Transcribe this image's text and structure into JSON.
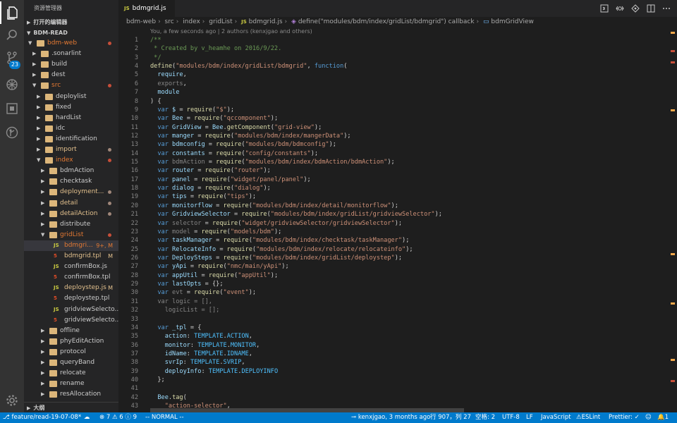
{
  "sidebar": {
    "title": "资源管理器",
    "open_editors": "打开的编辑器",
    "workspace": "BDM-READ",
    "outline": "大纲",
    "tree": [
      {
        "label": "bdm-web",
        "level": 1,
        "kind": "folder-open",
        "color": "#e37933",
        "status": "",
        "dot": "#c74e39"
      },
      {
        "label": ".sonarlint",
        "level": 2,
        "kind": "folder",
        "color": "#cccccc",
        "status": "",
        "dot": ""
      },
      {
        "label": "build",
        "level": 2,
        "kind": "folder",
        "color": "#cccccc",
        "status": "",
        "dot": ""
      },
      {
        "label": "dest",
        "level": 2,
        "kind": "folder",
        "color": "#cccccc",
        "status": "",
        "dot": ""
      },
      {
        "label": "src",
        "level": 2,
        "kind": "folder-open",
        "color": "#e37933",
        "status": "",
        "dot": "#c74e39"
      },
      {
        "label": "deploylist",
        "level": 3,
        "kind": "folder",
        "color": "#cccccc",
        "status": "",
        "dot": ""
      },
      {
        "label": "fixed",
        "level": 3,
        "kind": "folder",
        "color": "#cccccc",
        "status": "",
        "dot": ""
      },
      {
        "label": "hardList",
        "level": 3,
        "kind": "folder",
        "color": "#cccccc",
        "status": "",
        "dot": ""
      },
      {
        "label": "idc",
        "level": 3,
        "kind": "folder",
        "color": "#cccccc",
        "status": "",
        "dot": ""
      },
      {
        "label": "identification",
        "level": 3,
        "kind": "folder",
        "color": "#cccccc",
        "status": "",
        "dot": ""
      },
      {
        "label": "import",
        "level": 3,
        "kind": "folder",
        "color": "#e2c08d",
        "status": "",
        "dot": "#a0877a"
      },
      {
        "label": "index",
        "level": 3,
        "kind": "folder-open",
        "color": "#e37933",
        "status": "",
        "dot": "#c74e39"
      },
      {
        "label": "bdmAction",
        "level": 4,
        "kind": "folder",
        "color": "#cccccc",
        "status": "",
        "dot": ""
      },
      {
        "label": "checktask",
        "level": 4,
        "kind": "folder",
        "color": "#cccccc",
        "status": "",
        "dot": ""
      },
      {
        "label": "deployment...",
        "level": 4,
        "kind": "folder",
        "color": "#e2c08d",
        "status": "",
        "dot": "#a0877a"
      },
      {
        "label": "detail",
        "level": 4,
        "kind": "folder",
        "color": "#e2c08d",
        "status": "",
        "dot": "#a0877a"
      },
      {
        "label": "detailAction",
        "level": 4,
        "kind": "folder",
        "color": "#e2c08d",
        "status": "",
        "dot": "#a0877a"
      },
      {
        "label": "distribute",
        "level": 4,
        "kind": "folder",
        "color": "#cccccc",
        "status": "",
        "dot": ""
      },
      {
        "label": "gridList",
        "level": 4,
        "kind": "folder-open",
        "color": "#e37933",
        "status": "",
        "dot": "#c74e39"
      },
      {
        "label": "bdmgri...",
        "level": 5,
        "kind": "js",
        "color": "#e37933",
        "status": "9+, M",
        "dot": "",
        "selected": true
      },
      {
        "label": "bdmgrid.tpl",
        "level": 5,
        "kind": "html",
        "color": "#e2c08d",
        "status": "M",
        "dot": ""
      },
      {
        "label": "confirmBox.js",
        "level": 5,
        "kind": "js",
        "color": "#cccccc",
        "status": "",
        "dot": ""
      },
      {
        "label": "confirmBox.tpl",
        "level": 5,
        "kind": "html",
        "color": "#cccccc",
        "status": "",
        "dot": ""
      },
      {
        "label": "deploystep.js",
        "level": 5,
        "kind": "js",
        "color": "#e2c08d",
        "status": "M",
        "dot": ""
      },
      {
        "label": "deploystep.tpl",
        "level": 5,
        "kind": "html",
        "color": "#cccccc",
        "status": "",
        "dot": ""
      },
      {
        "label": "gridviewSelecto...",
        "level": 5,
        "kind": "js",
        "color": "#cccccc",
        "status": "",
        "dot": ""
      },
      {
        "label": "gridviewSelecto...",
        "level": 5,
        "kind": "html",
        "color": "#cccccc",
        "status": "",
        "dot": ""
      },
      {
        "label": "offline",
        "level": 4,
        "kind": "folder",
        "color": "#cccccc",
        "status": "",
        "dot": ""
      },
      {
        "label": "phyEditAction",
        "level": 4,
        "kind": "folder",
        "color": "#cccccc",
        "status": "",
        "dot": ""
      },
      {
        "label": "protocol",
        "level": 4,
        "kind": "folder",
        "color": "#cccccc",
        "status": "",
        "dot": ""
      },
      {
        "label": "queryBand",
        "level": 4,
        "kind": "folder",
        "color": "#cccccc",
        "status": "",
        "dot": ""
      },
      {
        "label": "relocate",
        "level": 4,
        "kind": "folder",
        "color": "#cccccc",
        "status": "",
        "dot": ""
      },
      {
        "label": "rename",
        "level": 4,
        "kind": "folder",
        "color": "#cccccc",
        "status": "",
        "dot": ""
      },
      {
        "label": "resAllocation",
        "level": 4,
        "kind": "folder",
        "color": "#cccccc",
        "status": "",
        "dot": ""
      }
    ]
  },
  "activity": {
    "scm_badge": "23"
  },
  "tab": {
    "label": "bdmgrid.js",
    "icon_text": "JS"
  },
  "breadcrumb": {
    "items": [
      "bdm-web",
      "src",
      "index",
      "gridList",
      "bdmgrid.js",
      "define(\"modules/bdm/index/gridList/bdmgrid\") callback",
      "bdmGridView"
    ],
    "js_icon": "JS"
  },
  "editor": {
    "blame": "You, a few seconds ago | 2 authors (kenxjgao and others)",
    "lines": [
      [
        [
          "c-com",
          "/**"
        ]
      ],
      [
        [
          "c-com",
          " * Created by v_heamhe on 2016/9/22."
        ]
      ],
      [
        [
          "c-com",
          " */"
        ]
      ],
      [
        [
          "c-fn",
          "define"
        ],
        [
          "",
          "("
        ],
        [
          "c-str",
          "\"modules/bdm/index/gridList/bdmgrid\""
        ],
        [
          "",
          ", "
        ],
        [
          "c-kw",
          "function"
        ],
        [
          "",
          "("
        ]
      ],
      [
        [
          "c-var",
          "  require"
        ],
        [
          "",
          ","
        ]
      ],
      [
        [
          "c-dim",
          "  exports"
        ],
        [
          "",
          ","
        ]
      ],
      [
        [
          "c-var",
          "  module"
        ]
      ],
      [
        [
          "",
          ") {"
        ]
      ],
      [
        [
          "c-kw",
          "  var"
        ],
        [
          "c-var",
          " $"
        ],
        [
          "",
          " = "
        ],
        [
          "c-fn",
          "require"
        ],
        [
          "",
          "("
        ],
        [
          "c-str",
          "\"$\""
        ],
        [
          "",
          ");"
        ]
      ],
      [
        [
          "c-kw",
          "  var"
        ],
        [
          "c-var",
          " Bee"
        ],
        [
          "",
          " = "
        ],
        [
          "c-fn",
          "require"
        ],
        [
          "",
          "("
        ],
        [
          "c-str",
          "\"qccomponent\""
        ],
        [
          "",
          ");"
        ]
      ],
      [
        [
          "c-kw",
          "  var"
        ],
        [
          "c-var",
          " GridView"
        ],
        [
          "",
          " = "
        ],
        [
          "c-var",
          "Bee"
        ],
        [
          "",
          "."
        ],
        [
          "c-fn",
          "getComponent"
        ],
        [
          "",
          "("
        ],
        [
          "c-str",
          "\"grid-view\""
        ],
        [
          "",
          ");"
        ]
      ],
      [
        [
          "c-kw",
          "  var"
        ],
        [
          "c-var",
          " manger"
        ],
        [
          "",
          " = "
        ],
        [
          "c-fn",
          "require"
        ],
        [
          "",
          "("
        ],
        [
          "c-str",
          "\"modules/bdm/index/mangerData\""
        ],
        [
          "",
          ");"
        ]
      ],
      [
        [
          "c-kw",
          "  var"
        ],
        [
          "c-var",
          " bdmconfig"
        ],
        [
          "",
          " = "
        ],
        [
          "c-fn",
          "require"
        ],
        [
          "",
          "("
        ],
        [
          "c-str",
          "\"modules/bdm/bdmconfig\""
        ],
        [
          "",
          ");"
        ]
      ],
      [
        [
          "c-kw",
          "  var"
        ],
        [
          "c-var",
          " constants"
        ],
        [
          "",
          " = "
        ],
        [
          "c-fn",
          "require"
        ],
        [
          "",
          "("
        ],
        [
          "c-str",
          "\"config/constants\""
        ],
        [
          "",
          ");"
        ]
      ],
      [
        [
          "c-kw",
          "  var"
        ],
        [
          "c-dim",
          " bdmAction"
        ],
        [
          "",
          " = "
        ],
        [
          "c-fn",
          "require"
        ],
        [
          "",
          "("
        ],
        [
          "c-str",
          "\"modules/bdm/index/bdmAction/bdmAction\""
        ],
        [
          "",
          ");"
        ]
      ],
      [
        [
          "c-kw",
          "  var"
        ],
        [
          "c-var",
          " router"
        ],
        [
          "",
          " = "
        ],
        [
          "c-fn",
          "require"
        ],
        [
          "",
          "("
        ],
        [
          "c-str",
          "\"router\""
        ],
        [
          "",
          ");"
        ]
      ],
      [
        [
          "c-kw",
          "  var"
        ],
        [
          "c-var",
          " panel"
        ],
        [
          "",
          " = "
        ],
        [
          "c-fn",
          "require"
        ],
        [
          "",
          "("
        ],
        [
          "c-str",
          "\"widget/panel/panel\""
        ],
        [
          "",
          ");"
        ]
      ],
      [
        [
          "c-kw",
          "  var"
        ],
        [
          "c-var",
          " dialog"
        ],
        [
          "",
          " = "
        ],
        [
          "c-fn",
          "require"
        ],
        [
          "",
          "("
        ],
        [
          "c-str",
          "\"dialog\""
        ],
        [
          "",
          ");"
        ]
      ],
      [
        [
          "c-kw",
          "  var"
        ],
        [
          "c-var",
          " tips"
        ],
        [
          "",
          " = "
        ],
        [
          "c-fn",
          "require"
        ],
        [
          "",
          "("
        ],
        [
          "c-str",
          "\"tips\""
        ],
        [
          "",
          ");"
        ]
      ],
      [
        [
          "c-kw",
          "  var"
        ],
        [
          "c-var",
          " monitorflow"
        ],
        [
          "",
          " = "
        ],
        [
          "c-fn",
          "require"
        ],
        [
          "",
          "("
        ],
        [
          "c-str",
          "\"modules/bdm/index/detail/monitorflow\""
        ],
        [
          "",
          ");"
        ]
      ],
      [
        [
          "c-kw",
          "  var"
        ],
        [
          "c-var",
          " GridviewSelector"
        ],
        [
          "",
          " = "
        ],
        [
          "c-fn",
          "require"
        ],
        [
          "",
          "("
        ],
        [
          "c-str",
          "\"modules/bdm/index/gridList/gridviewSelector\""
        ],
        [
          "",
          ");"
        ]
      ],
      [
        [
          "c-kw",
          "  var"
        ],
        [
          "c-dim",
          " selector"
        ],
        [
          "",
          " = "
        ],
        [
          "c-fn",
          "require"
        ],
        [
          "",
          "("
        ],
        [
          "c-str",
          "\"widget/gridviewSelector/gridviewSelector\""
        ],
        [
          "",
          ");"
        ]
      ],
      [
        [
          "c-kw",
          "  var"
        ],
        [
          "c-dim",
          " model"
        ],
        [
          "",
          " = "
        ],
        [
          "c-fn",
          "require"
        ],
        [
          "",
          "("
        ],
        [
          "c-str",
          "\"models/bdm\""
        ],
        [
          "",
          ");"
        ]
      ],
      [
        [
          "c-kw",
          "  var"
        ],
        [
          "c-var",
          " taskManager"
        ],
        [
          "",
          " = "
        ],
        [
          "c-fn",
          "require"
        ],
        [
          "",
          "("
        ],
        [
          "c-str",
          "\"modules/bdm/index/checktask/taskManager\""
        ],
        [
          "",
          ");"
        ]
      ],
      [
        [
          "c-kw",
          "  var"
        ],
        [
          "c-var",
          " RelocateInfo"
        ],
        [
          "",
          " = "
        ],
        [
          "c-fn",
          "require"
        ],
        [
          "",
          "("
        ],
        [
          "c-str",
          "\"modules/bdm/index/relocate/relocateinfo\""
        ],
        [
          "",
          ");"
        ]
      ],
      [
        [
          "c-kw",
          "  var"
        ],
        [
          "c-var",
          " DeploySteps"
        ],
        [
          "",
          " = "
        ],
        [
          "c-fn",
          "require"
        ],
        [
          "",
          "("
        ],
        [
          "c-str",
          "\"modules/bdm/index/gridList/deploystep\""
        ],
        [
          "",
          ");"
        ]
      ],
      [
        [
          "c-kw",
          "  var"
        ],
        [
          "c-var",
          " yApi"
        ],
        [
          "",
          " = "
        ],
        [
          "c-fn",
          "require"
        ],
        [
          "",
          "("
        ],
        [
          "c-str",
          "\"nmc/main/yApi\""
        ],
        [
          "",
          ");"
        ]
      ],
      [
        [
          "c-kw",
          "  var"
        ],
        [
          "c-var",
          " appUtil"
        ],
        [
          "",
          " = "
        ],
        [
          "c-fn",
          "require"
        ],
        [
          "",
          "("
        ],
        [
          "c-str",
          "\"appUtil\""
        ],
        [
          "",
          ");"
        ]
      ],
      [
        [
          "c-kw",
          "  var"
        ],
        [
          "c-var",
          " lastOpts"
        ],
        [
          "",
          " = {};"
        ]
      ],
      [
        [
          "c-kw",
          "  var"
        ],
        [
          "c-dim",
          " evt"
        ],
        [
          "",
          " = "
        ],
        [
          "c-fn",
          "require"
        ],
        [
          "",
          "("
        ],
        [
          "c-str",
          "\"event\""
        ],
        [
          "",
          ");"
        ]
      ],
      [
        [
          "c-dim",
          "  var logic"
        ],
        [
          "c-dim",
          " = [],"
        ]
      ],
      [
        [
          "c-dim",
          "    logicList"
        ],
        [
          "c-dim",
          " = [];"
        ]
      ],
      [
        [
          "",
          ""
        ]
      ],
      [
        [
          "c-kw",
          "  var"
        ],
        [
          "c-var",
          " _tpl"
        ],
        [
          "",
          " = {"
        ]
      ],
      [
        [
          "c-var",
          "    action"
        ],
        [
          "",
          ": "
        ],
        [
          "c-const",
          "TEMPLATE"
        ],
        [
          "",
          "."
        ],
        [
          "c-const",
          "ACTION"
        ],
        [
          "",
          ","
        ]
      ],
      [
        [
          "c-var",
          "    monitor"
        ],
        [
          "",
          ": "
        ],
        [
          "c-const",
          "TEMPLATE"
        ],
        [
          "",
          "."
        ],
        [
          "c-const",
          "MONITOR"
        ],
        [
          "",
          ","
        ]
      ],
      [
        [
          "c-var",
          "    idName"
        ],
        [
          "",
          ": "
        ],
        [
          "c-const",
          "TEMPLATE"
        ],
        [
          "",
          "."
        ],
        [
          "c-const",
          "IDNAME"
        ],
        [
          "",
          ","
        ]
      ],
      [
        [
          "c-var",
          "    svrIp"
        ],
        [
          "",
          ": "
        ],
        [
          "c-const",
          "TEMPLATE"
        ],
        [
          "",
          "."
        ],
        [
          "c-const",
          "SVRIP"
        ],
        [
          "",
          ","
        ]
      ],
      [
        [
          "c-var",
          "    deployInfo"
        ],
        [
          "",
          ": "
        ],
        [
          "c-const",
          "TEMPLATE"
        ],
        [
          "",
          "."
        ],
        [
          "c-const",
          "DEPLOYINFO"
        ]
      ],
      [
        [
          "",
          "  };"
        ]
      ],
      [
        [
          "",
          ""
        ]
      ],
      [
        [
          "c-var",
          "  Bee"
        ],
        [
          "",
          "."
        ],
        [
          "c-fn",
          "tag"
        ],
        [
          "",
          "("
        ]
      ],
      [
        [
          "c-str",
          "    \"action-selector\""
        ],
        [
          "",
          ","
        ]
      ]
    ]
  },
  "status": {
    "branch": "feature/read-19-07-08*",
    "problems_errors": "7",
    "problems_warnings": "6",
    "problems_info": "9",
    "mode": "-- NORMAL --",
    "blame": "kenxjgao, 3 months ago",
    "position": "行 907，列 27",
    "indent": "空格: 2",
    "encoding": "UTF-8",
    "eol": "LF",
    "language": "JavaScript",
    "eslint": "ESLint",
    "prettier": "Prettier: ✓",
    "notifications": "1"
  }
}
